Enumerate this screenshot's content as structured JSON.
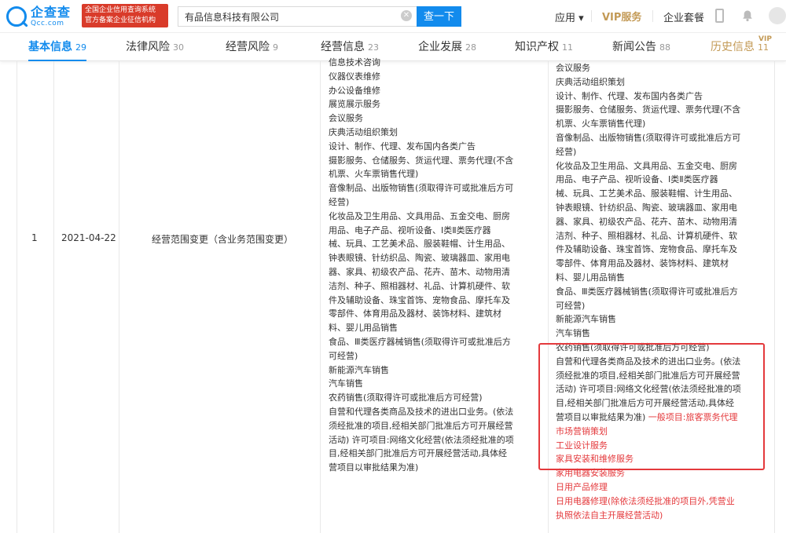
{
  "header": {
    "logo_cn": "企查查",
    "logo_en": "Qcc.com",
    "badge_line1": "全国企业信用查询系统",
    "badge_line2": "官方备案企业征信机构",
    "search_value": "有品信息科技有限公司",
    "search_button": "查一下",
    "apps": "应用 ▾",
    "vip": "VIP服务",
    "package": "企业套餐"
  },
  "tabs": [
    {
      "label": "基本信息",
      "count": "29"
    },
    {
      "label": "法律风险",
      "count": "30"
    },
    {
      "label": "经营风险",
      "count": "9"
    },
    {
      "label": "经营信息",
      "count": "23"
    },
    {
      "label": "企业发展",
      "count": "28"
    },
    {
      "label": "知识产权",
      "count": "11"
    },
    {
      "label": "新闻公告",
      "count": "88"
    },
    {
      "label": "历史信息",
      "count": "11"
    }
  ],
  "vip_tag": "VIP",
  "row": {
    "index": "1",
    "date": "2021-04-22",
    "item": "经营范围变更（含业务范围变更）",
    "before": [
      "信息技术咨询",
      "仪器仪表维修",
      "办公设备维修",
      "展览展示服务",
      "会议服务",
      "庆典活动组织策划",
      "设计、制作、代理、发布国内各类广告",
      "摄影服务、仓储服务、货运代理、票务代理(不含",
      "机票、火车票销售代理)",
      "音像制品、出版物销售(须取得许可或批准后方可",
      "经营)",
      "化妆品及卫生用品、文具用品、五金交电、厨房",
      "用品、电子产品、视听设备、Ⅰ类Ⅱ类医疗器",
      "械、玩具、工艺美术品、服装鞋帽、计生用品、",
      "钟表眼镜、针纺织品、陶瓷、玻璃器皿、家用电",
      "器、家具、初级农产品、花卉、苗木、动物用清",
      "洁剂、种子、照相器材、礼品、计算机硬件、软",
      "件及辅助设备、珠宝首饰、宠物食品、摩托车及",
      "零部件、体育用品及器材、装饰材料、建筑材",
      "料、婴儿用品销售",
      "食品、Ⅲ类医疗器械销售(须取得许可或批准后方",
      "可经营)",
      "新能源汽车销售",
      "汽车销售",
      "农药销售(须取得许可或批准后方可经营)",
      "自营和代理各类商品及技术的进出口业务。(依法",
      "须经批准的项目,经相关部门批准后方可开展经营",
      "活动) 许可项目:网络文化经营(依法须经批准的项",
      "目,经相关部门批准后方可开展经营活动,具体经",
      "营项目以审批结果为准)"
    ],
    "after": [
      "会议服务",
      "庆典活动组织策划",
      "设计、制作、代理、发布国内各类广告",
      "摄影服务、仓储服务、货运代理、票务代理(不含",
      "机票、火车票销售代理)",
      "音像制品、出版物销售(须取得许可或批准后方可",
      "经营)",
      "化妆品及卫生用品、文具用品、五金交电、厨房",
      "用品、电子产品、视听设备、Ⅰ类Ⅱ类医疗器",
      "械、玩具、工艺美术品、服装鞋帽、计生用品、",
      "钟表眼镜、针纺织品、陶瓷、玻璃器皿、家用电",
      "器、家具、初级农产品、花卉、苗木、动物用清",
      "洁剂、种子、照相器材、礼品、计算机硬件、软",
      "件及辅助设备、珠宝首饰、宠物食品、摩托车及",
      "零部件、体育用品及器材、装饰材料、建筑材",
      "料、婴儿用品销售",
      "食品、Ⅲ类医疗器械销售(须取得许可或批准后方",
      "可经营)",
      "新能源汽车销售",
      "汽车销售",
      "农药销售(须取得许可或批准后方可经营)",
      "自营和代理各类商品及技术的进出口业务。(依法",
      "须经批准的项目,经相关部门批准后方可开展经营",
      "活动) 许可项目:网络文化经营(依法须经批准的项",
      "目,经相关部门批准后方可开展经营活动,具体经"
    ],
    "after_mixed_black": "营项目以审批结果为准)",
    "after_mixed_red": " 一般项目:旅客票务代理",
    "after_red": [
      "市场营销策划",
      "工业设计服务",
      "家具安装和维修服务",
      "家用电器安装服务",
      "日用产品修理",
      "日用电器修理(除依法须经批准的项目外,凭营业",
      "执照依法自主开展经营活动)"
    ]
  },
  "colors": {
    "accent": "#128bed",
    "highlight": "#e4393c",
    "vip_gold": "#c39a56",
    "badge_red": "#d93b2a"
  }
}
